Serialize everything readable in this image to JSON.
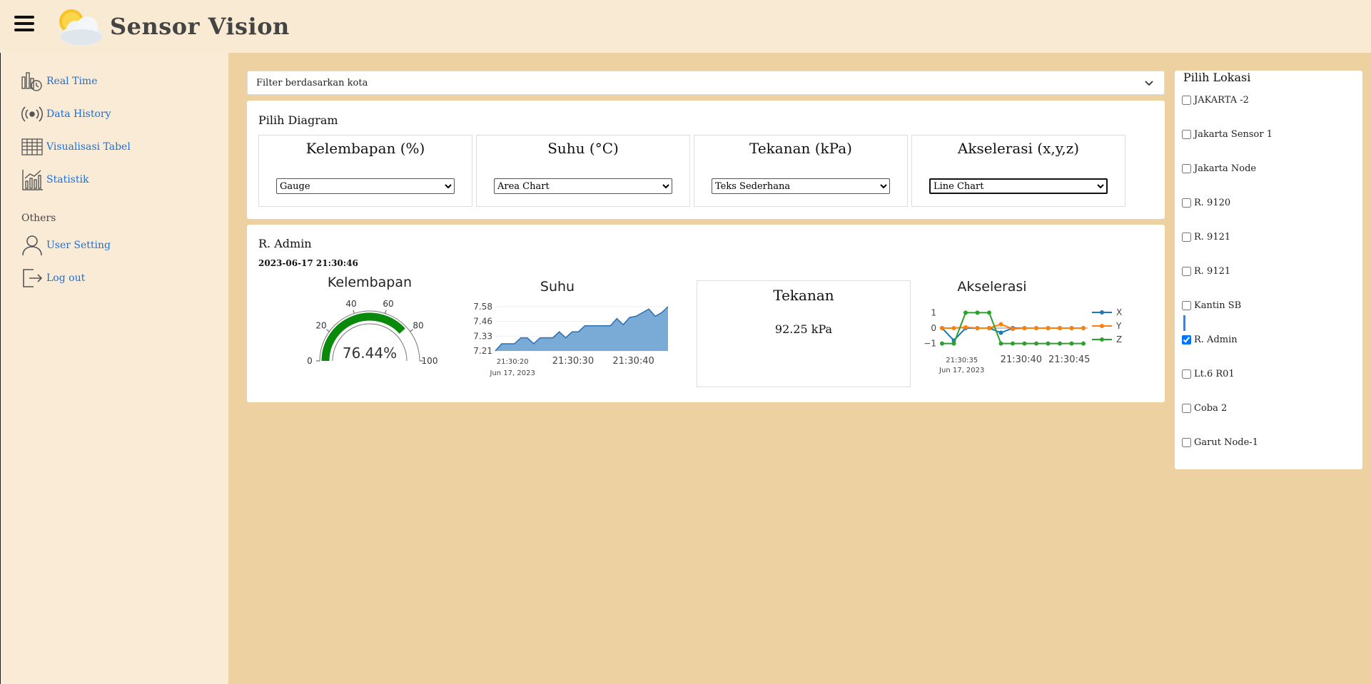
{
  "app": {
    "title": "Sensor Vision"
  },
  "icons": {
    "menu": "hamburger-icon",
    "logo": "sun-cloud-icon"
  },
  "sidebar": {
    "items": [
      {
        "label": "Real Time",
        "icon": "realtime-icon"
      },
      {
        "label": "Data History",
        "icon": "broadcast-icon"
      },
      {
        "label": "Visualisasi Tabel",
        "icon": "table-icon"
      },
      {
        "label": "Statistik",
        "icon": "statistics-icon"
      }
    ],
    "others_label": "Others",
    "others": [
      {
        "label": "User Setting",
        "icon": "user-icon"
      },
      {
        "label": "Log out",
        "icon": "logout-icon"
      }
    ]
  },
  "filter": {
    "placeholder": "Filter berdasarkan kota"
  },
  "diagram": {
    "title": "Pilih Diagram",
    "cells": [
      {
        "heading": "Kelembapan (%)",
        "selected": "Gauge"
      },
      {
        "heading": "Suhu (°C)",
        "selected": "Area Chart"
      },
      {
        "heading": "Tekanan (kPa)",
        "selected": "Teks Sederhana"
      },
      {
        "heading": "Akselerasi (x,y,z)",
        "selected": "Line Chart"
      }
    ]
  },
  "data_card": {
    "title": "R. Admin",
    "timestamp": "2023-06-17 21:30:46",
    "tekanan_title": "Tekanan",
    "tekanan_value": "92.25 kPa"
  },
  "locations": {
    "title": "Pilih Lokasi",
    "items": [
      {
        "label": "JAKARTA -2",
        "checked": false
      },
      {
        "label": "Jakarta Sensor 1",
        "checked": false
      },
      {
        "label": "Jakarta Node",
        "checked": false
      },
      {
        "label": "R. 9120",
        "checked": false
      },
      {
        "label": "R. 9121",
        "checked": false
      },
      {
        "label": "R. 9121",
        "checked": false
      },
      {
        "label": "Kantin SB",
        "checked": false
      },
      {
        "label": "R. Admin",
        "checked": true
      },
      {
        "label": "Lt.6 R01",
        "checked": false
      },
      {
        "label": "Coba 2",
        "checked": false
      },
      {
        "label": "Garut Node-1",
        "checked": false
      }
    ]
  },
  "colors": {
    "accent": "#1a6fd8",
    "gauge_fill": "#0a8a0a",
    "area": "#7aaad6",
    "area_line": "#2c6fb1",
    "x": "#1f77b4",
    "y": "#ff7f0e",
    "z": "#2ca02c"
  },
  "chart_data": [
    {
      "type": "gauge",
      "title": "Kelembapan",
      "value": 76.44,
      "value_label": "76.44%",
      "range": [
        0,
        100
      ],
      "ticks": [
        "0",
        "20",
        "40",
        "60",
        "80",
        "100"
      ]
    },
    {
      "type": "area",
      "title": "Suhu",
      "x_tick_labels": [
        "21:30:20",
        "21:30:30",
        "21:30:40"
      ],
      "x_sublabel": "Jun 17, 2023",
      "y_tick_labels": [
        "7.21",
        "7.33",
        "7.46",
        "7.58"
      ],
      "ylim": [
        7.21,
        7.58
      ],
      "values": [
        7.21,
        7.27,
        7.27,
        7.27,
        7.32,
        7.32,
        7.27,
        7.32,
        7.32,
        7.32,
        7.37,
        7.32,
        7.37,
        7.37,
        7.42,
        7.42,
        7.42,
        7.42,
        7.42,
        7.48,
        7.43,
        7.49,
        7.5,
        7.53,
        7.56,
        7.5,
        7.53,
        7.58
      ]
    },
    {
      "type": "line",
      "title": "Akselerasi",
      "x_tick_labels": [
        "21:30:35",
        "21:30:40",
        "21:30:45"
      ],
      "x_sublabel": "Jun 17, 2023",
      "y_tick_labels": [
        "1",
        "0",
        "−1"
      ],
      "ylim": [
        -1.2,
        1.2
      ],
      "series": [
        {
          "name": "X",
          "values": [
            0,
            -0.8,
            0,
            0,
            0,
            -0.3,
            0,
            0,
            0,
            0,
            0,
            0,
            0
          ]
        },
        {
          "name": "Y",
          "values": [
            0,
            0,
            0.05,
            0,
            0,
            0.25,
            -0.05,
            0,
            0,
            0,
            0,
            0,
            0
          ]
        },
        {
          "name": "Z",
          "values": [
            -1,
            -1,
            1,
            1,
            1,
            -1,
            -1,
            -1,
            -1,
            -1,
            -1,
            -1,
            -1
          ]
        }
      ]
    }
  ]
}
